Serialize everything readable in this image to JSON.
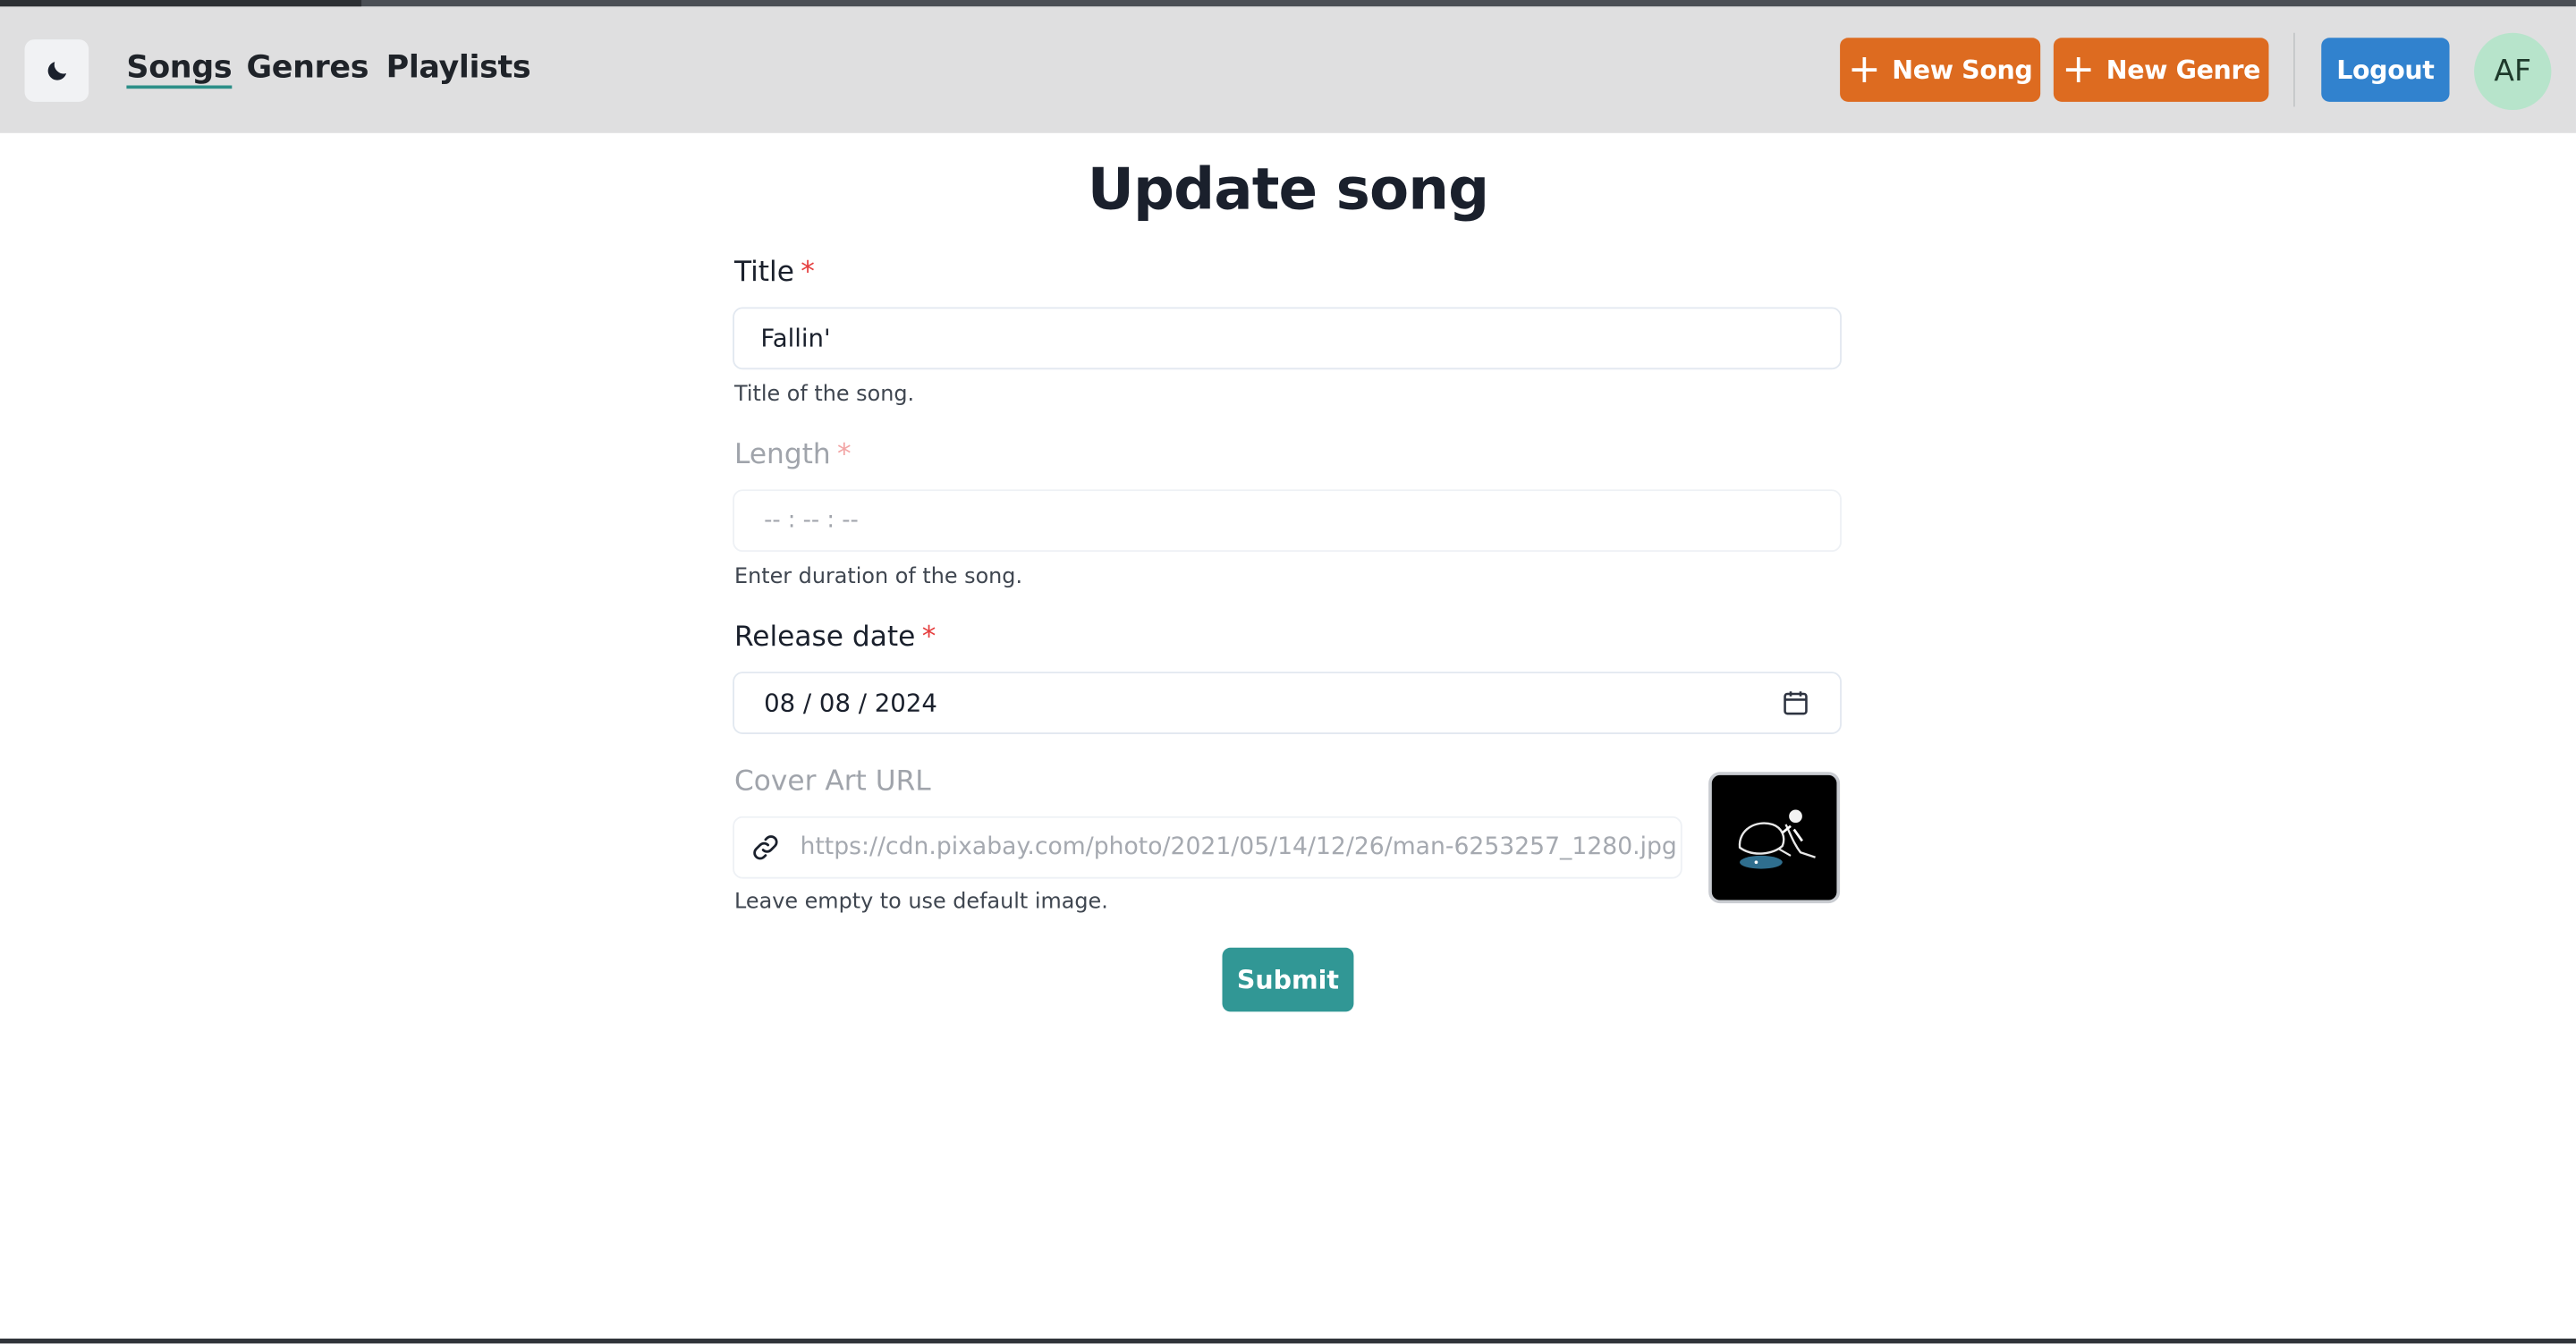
{
  "navbar": {
    "theme_toggle_icon": "moon-icon",
    "links": [
      "Songs",
      "Genres",
      "Playlists"
    ],
    "active_link": "Songs",
    "new_song_label": "New Song",
    "new_genre_label": "New Genre",
    "logout_label": "Logout",
    "avatar_initials": "AF",
    "colors": {
      "orange": "#dd6b20",
      "blue": "#3182ce",
      "avatar": "#b7e4cb"
    }
  },
  "form": {
    "title": "Update song",
    "title_field": {
      "label": "Title",
      "required_mark": "*",
      "value": "Fallin'",
      "helper": "Title of the song."
    },
    "length_field": {
      "label": "Length",
      "required_mark": "*",
      "placeholder": "-- : -- : --",
      "helper": "Enter duration of the song.",
      "disabled": true
    },
    "release_date_field": {
      "label": "Release date",
      "required_mark": "*",
      "value": "08 / 08 / 2024",
      "icon": "calendar-icon"
    },
    "cover_art_field": {
      "label": "Cover Art URL",
      "placeholder": "https://cdn.pixabay.com/photo/2021/05/14/12/26/man-6253257_1280.jpg",
      "icon": "link-icon",
      "helper": "Leave empty to use default image."
    },
    "submit_label": "Submit",
    "colors": {
      "submit": "#319795",
      "required": "#e53e3e"
    }
  }
}
